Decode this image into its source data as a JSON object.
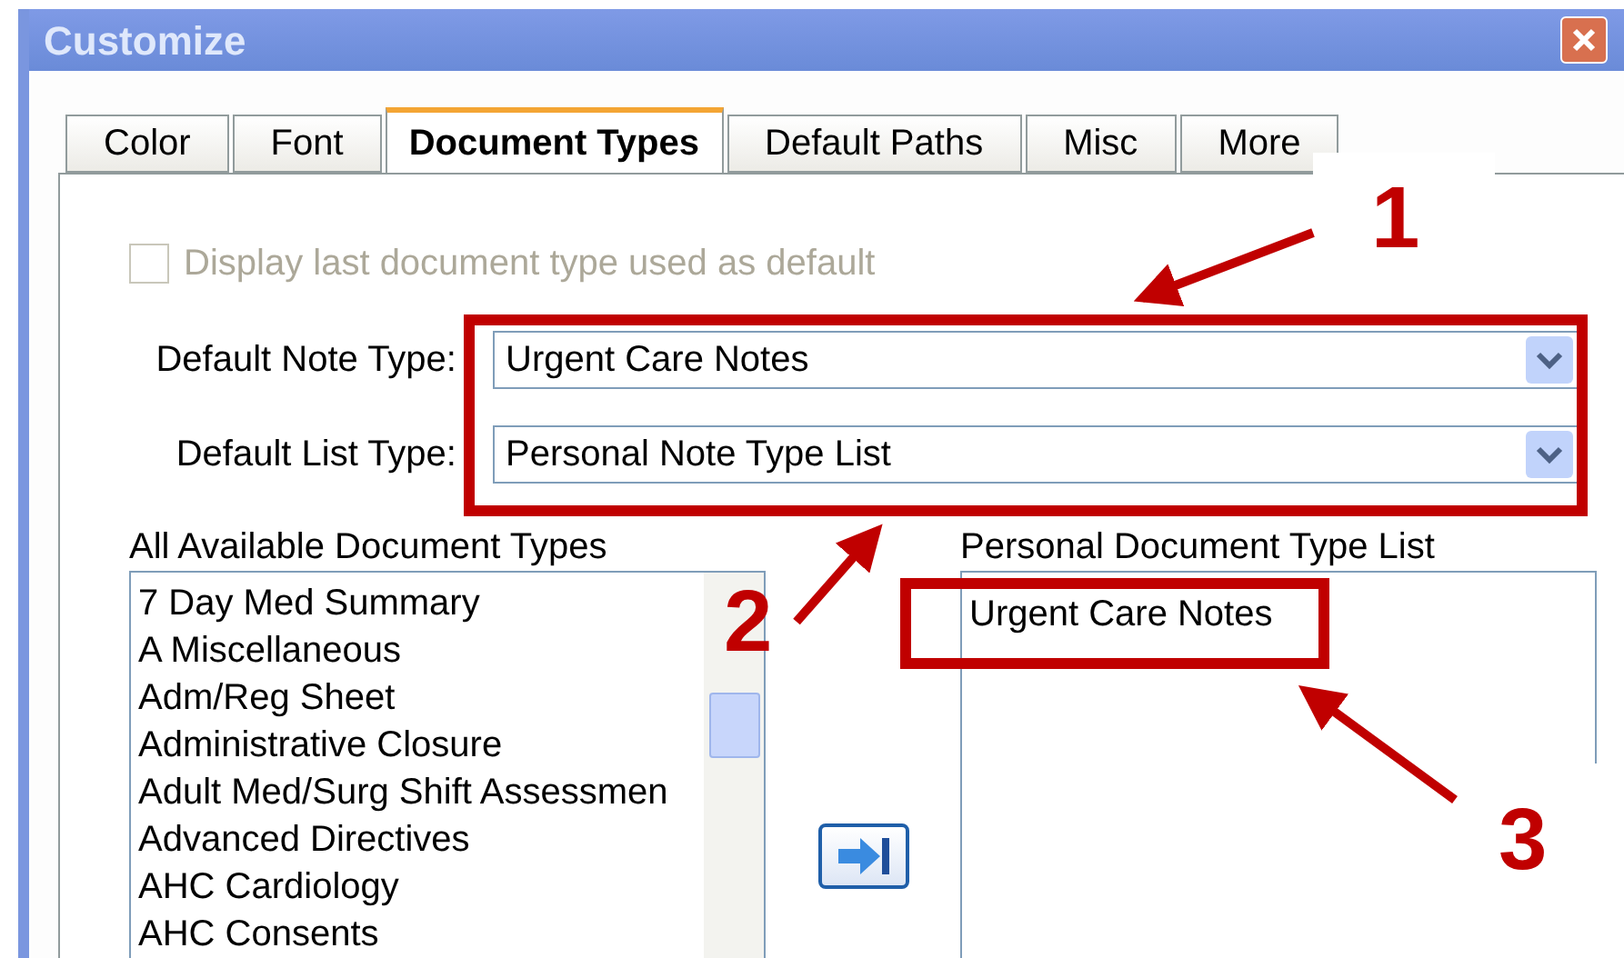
{
  "window": {
    "title": "Customize"
  },
  "tabs": [
    {
      "label": "Color",
      "selected": false
    },
    {
      "label": "Font",
      "selected": false
    },
    {
      "label": "Document Types",
      "selected": true
    },
    {
      "label": "Default Paths",
      "selected": false
    },
    {
      "label": "Misc",
      "selected": false
    },
    {
      "label": "More",
      "selected": false
    }
  ],
  "checkbox": {
    "label": "Display last document type used as default",
    "checked": false,
    "disabled": true
  },
  "fields": [
    {
      "label": "Default Note Type:",
      "value": "Urgent Care Notes"
    },
    {
      "label": "Default List Type:",
      "value": "Personal Note Type List"
    }
  ],
  "available_list": {
    "label": "All Available Document Types",
    "items": [
      "7 Day Med Summary",
      "A Miscellaneous",
      "Adm/Reg Sheet",
      "Administrative Closure",
      "Adult Med/Surg Shift Assessmen",
      "Advanced Directives",
      "AHC Cardiology",
      "AHC Consents"
    ]
  },
  "personal_list": {
    "label": "Personal Document Type List",
    "items": [
      "Urgent Care Notes"
    ]
  },
  "callouts": [
    "1",
    "2",
    "3"
  ]
}
